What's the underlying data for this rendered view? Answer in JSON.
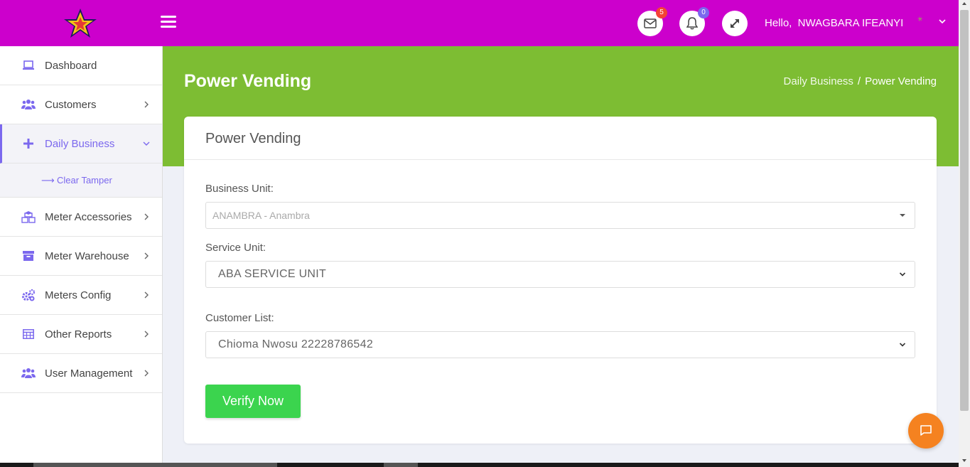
{
  "header": {
    "mail_badge": "5",
    "notification_badge": "0",
    "greeting": "Hello,  NWAGBARA IFEANYI"
  },
  "sidebar": {
    "items": [
      {
        "label": "Dashboard",
        "icon": "laptop-icon"
      },
      {
        "label": "Customers",
        "icon": "users-icon"
      },
      {
        "label": "Daily Business",
        "icon": "plus-icon",
        "active": true,
        "expanded": true
      },
      {
        "label": "Meter Accessories",
        "icon": "cubes-icon"
      },
      {
        "label": "Meter Warehouse",
        "icon": "archive-icon"
      },
      {
        "label": "Meters Config",
        "icon": "cogs-icon"
      },
      {
        "label": "Other Reports",
        "icon": "table-icon"
      },
      {
        "label": "User Management",
        "icon": "users-icon"
      }
    ],
    "subitems": [
      {
        "label": "Clear Tamper"
      }
    ]
  },
  "page": {
    "title": "Power Vending",
    "breadcrumb": [
      "Daily Business",
      "Power Vending"
    ]
  },
  "card": {
    "title": "Power Vending",
    "business_unit_label": "Business Unit:",
    "business_unit_value": "ANAMBRA - Anambra",
    "service_unit_label": "Service Unit:",
    "service_unit_value": "ABA SERVICE UNIT",
    "customer_list_label": "Customer List:",
    "customer_list_value": "Chioma Nwosu 22228786542",
    "verify_button": "Verify Now"
  },
  "colors": {
    "topbar": "#cc00cc",
    "banner": "#7dbd33",
    "accent": "#7b68ee",
    "button": "#3bd44e",
    "chat": "#f58220"
  }
}
